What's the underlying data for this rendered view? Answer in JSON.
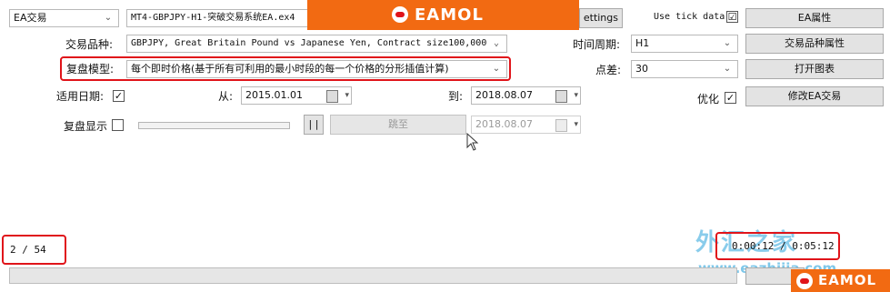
{
  "ea_type": {
    "value": "EA交易"
  },
  "expert": {
    "value": "MT4-GBPJPY-H1-突破交易系统EA.ex4"
  },
  "settings_button": "ettings",
  "use_tick_data": {
    "label": "Use tick data",
    "checked": "☑"
  },
  "ea_properties_button": "EA属性",
  "symbol": {
    "label": "交易品种:",
    "value": "GBPJPY, Great Britain Pound vs Japanese Yen, Contract size100,000"
  },
  "period": {
    "label": "时间周期:",
    "value": "H1"
  },
  "symbol_properties_button": "交易品种属性",
  "model": {
    "label": "复盘模型:",
    "value": "每个即时价格(基于所有可利用的最小时段的每一个价格的分形插值计算)"
  },
  "spread": {
    "label": "点差:",
    "value": "30"
  },
  "open_chart_button": "打开图表",
  "use_date": {
    "label": "适用日期:",
    "checked": "✓"
  },
  "from": {
    "label": "从:",
    "value": "2015.01.01"
  },
  "to": {
    "label": "到:",
    "value": "2018.08.07"
  },
  "optimization": {
    "label": "优化",
    "checked": "✓"
  },
  "modify_ea_button": "修改EA交易",
  "visual_mode": {
    "label": "复盘显示"
  },
  "pause_button": "| |",
  "skip_to_button": "跳至",
  "skip_to_date": "2018.08.07",
  "progress": {
    "count": "2 / 54",
    "time": "0:00:12 / 0:05:12",
    "fill": 0.0
  },
  "watermarks": {
    "top_logo": "EAMOL",
    "bottom_logo": "EAMOL",
    "site_cn": "外汇之家",
    "site_url": "www.eazhijia.com"
  },
  "colors": {
    "highlight": "#e0141a",
    "brand_orange": "#f26a12"
  }
}
